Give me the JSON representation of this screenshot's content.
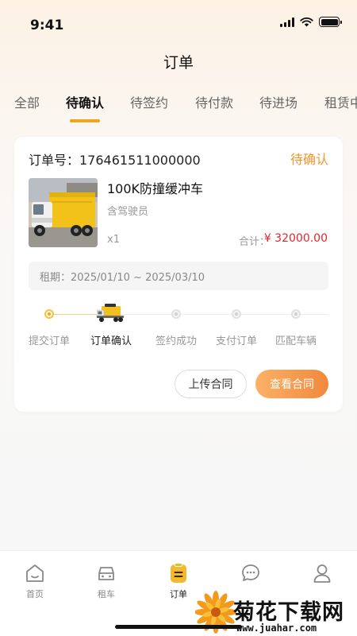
{
  "status_bar": {
    "time": "9:41"
  },
  "header": {
    "title": "订单"
  },
  "tabs": [
    {
      "label": "全部"
    },
    {
      "label": "待确认"
    },
    {
      "label": "待签约"
    },
    {
      "label": "待付款"
    },
    {
      "label": "待进场"
    },
    {
      "label": "租赁中"
    }
  ],
  "active_tab": "待确认",
  "order": {
    "order_no": "订单号：176461511000000",
    "status": "待确认",
    "product_name": "100K防撞缓冲车",
    "product_sub": "含驾驶员",
    "quantity": "x1",
    "total_label": "合计：",
    "total_value": "¥ 32000.00",
    "rent_period": "租期：2025/01/10 ~ 2025/03/10",
    "steps": [
      {
        "label": "提交订单",
        "state": "done"
      },
      {
        "label": "订单确认",
        "state": "current"
      },
      {
        "label": "签约成功",
        "state": "todo"
      },
      {
        "label": "支付订单",
        "state": "todo"
      },
      {
        "label": "匹配车辆",
        "state": "todo"
      }
    ],
    "upload_button": "上传合同",
    "view_button": "查看合同"
  },
  "tabbar": [
    {
      "label": "首页",
      "icon": "home-icon"
    },
    {
      "label": "租车",
      "icon": "car-icon"
    },
    {
      "label": "订单",
      "icon": "order-icon"
    },
    {
      "label": "",
      "icon": "message-icon"
    },
    {
      "label": "",
      "icon": "profile-icon"
    }
  ],
  "watermark": {
    "title": "菊花下载网",
    "url": "www.juahar.com"
  },
  "colors": {
    "accent": "#f0a51e",
    "status": "#f0962c",
    "price": "#e5242d",
    "button_gradient_start": "#fbb167",
    "button_gradient_end": "#f0893d"
  }
}
